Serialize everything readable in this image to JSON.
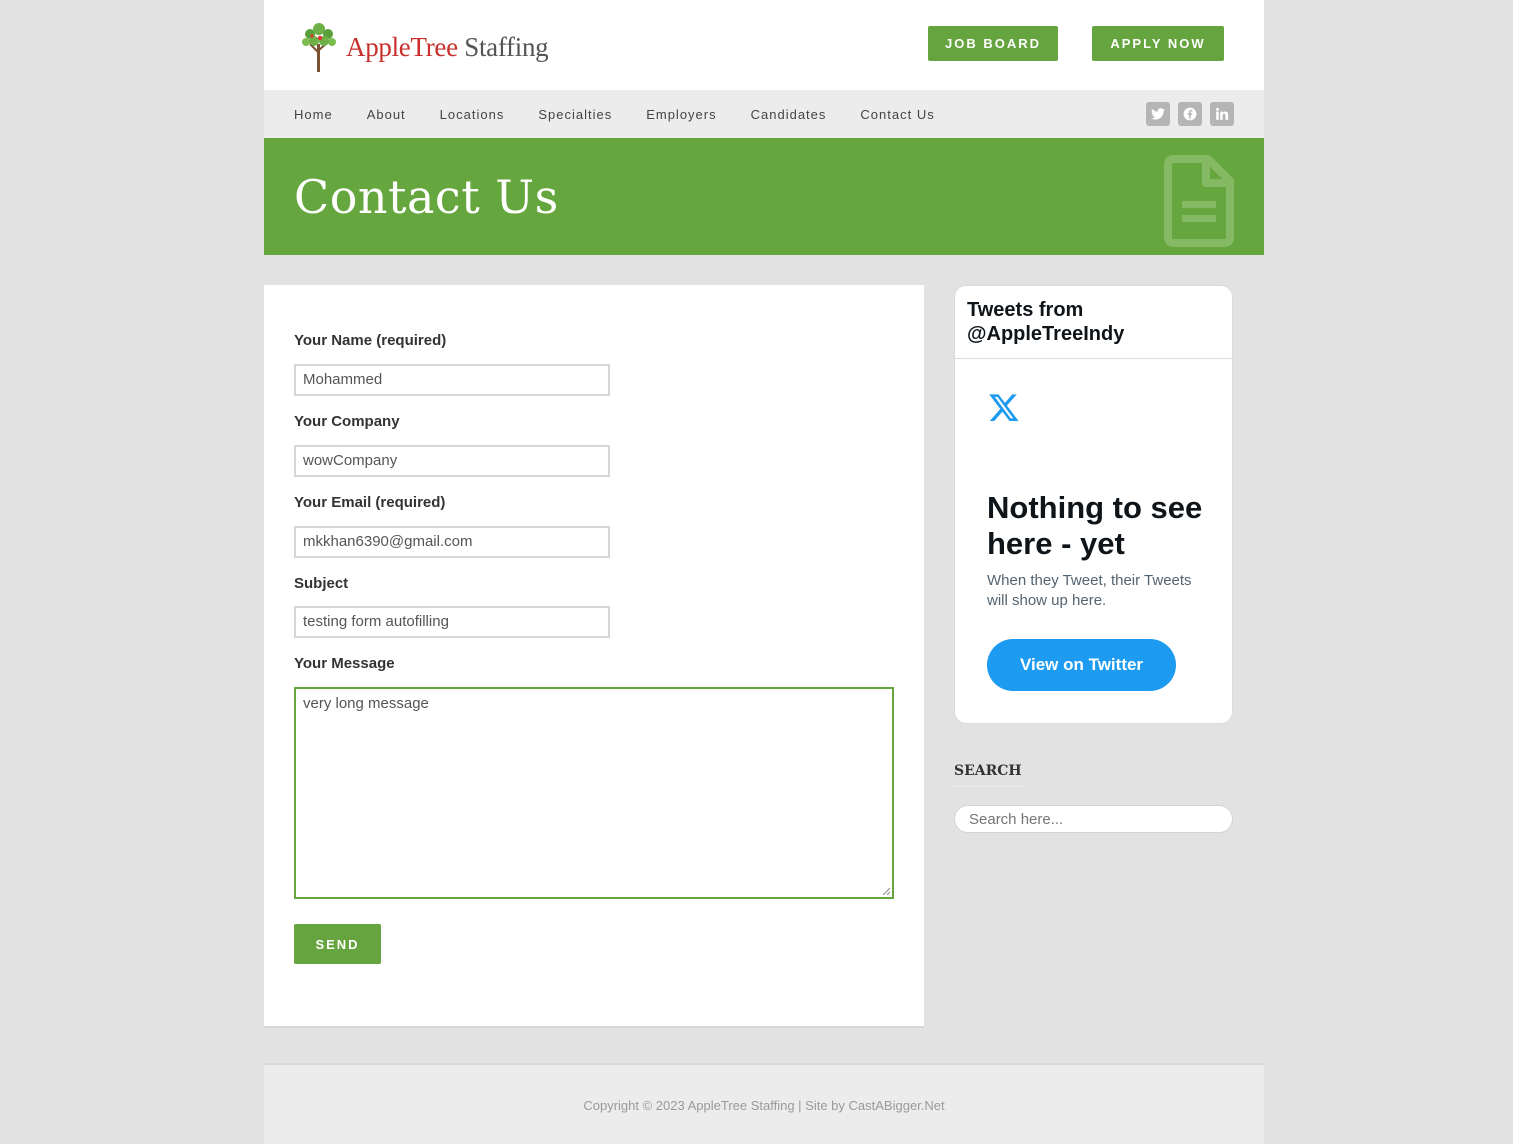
{
  "brand": {
    "name_part1": "AppleTree",
    "name_part2": "Staffing"
  },
  "header": {
    "job_board": "JOB BOARD",
    "apply_now": "APPLY NOW"
  },
  "nav": {
    "items": [
      "Home",
      "About",
      "Locations",
      "Specialties",
      "Employers",
      "Candidates",
      "Contact Us"
    ],
    "social": [
      "twitter-icon",
      "facebook-icon",
      "linkedin-icon"
    ]
  },
  "hero": {
    "title": "Contact Us",
    "icon": "document-icon"
  },
  "form": {
    "name_label": "Your Name (required)",
    "name_value": "Mohammed",
    "company_label": "Your Company",
    "company_value": "wowCompany",
    "email_label": "Your Email (required)",
    "email_value": "mkkhan6390@gmail.com",
    "subject_label": "Subject",
    "subject_value": "testing form autofilling",
    "message_label": "Your Message",
    "message_value": "very long message",
    "send": "SEND"
  },
  "twitter": {
    "header_line1": "Tweets from",
    "header_line2": "@AppleTreeIndy",
    "empty_title": "Nothing to see here - yet",
    "empty_sub": "When they Tweet, their Tweets will show up here.",
    "button": "View on Twitter"
  },
  "search": {
    "title": "SEARCH",
    "placeholder": "Search here..."
  },
  "footer": {
    "copyright": "Copyright © 2023 AppleTree Staffing | Site by CastABigger.Net"
  },
  "colors": {
    "brand_green": "#66a63f",
    "twitter_blue": "#1d9bf0",
    "logo_red": "#c8302c"
  }
}
